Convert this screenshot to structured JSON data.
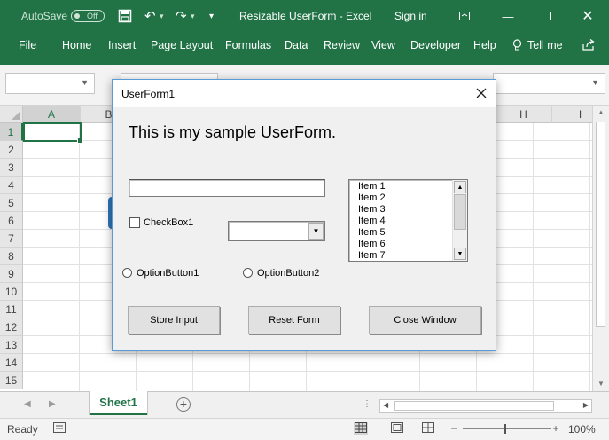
{
  "app": {
    "autosave_label": "AutoSave",
    "autosave_state": "Off",
    "title": "Resizable UserForm  -  Excel",
    "sign_in": "Sign in"
  },
  "ribbon": {
    "tabs": [
      "File",
      "Home",
      "Insert",
      "Page Layout",
      "Formulas",
      "Data",
      "Review",
      "View",
      "Developer",
      "Help",
      "Tell me"
    ]
  },
  "grid": {
    "columns": [
      "A",
      "B",
      "",
      "",
      "",
      "",
      "",
      "",
      "H",
      "I"
    ],
    "rows": [
      "1",
      "2",
      "3",
      "4",
      "5",
      "6",
      "7",
      "8",
      "9",
      "10",
      "11",
      "12",
      "13",
      "14",
      "15"
    ],
    "active_cell": "A1"
  },
  "sheet": {
    "tab_name": "Sheet1"
  },
  "status": {
    "ready": "Ready",
    "zoom": "100%"
  },
  "userform": {
    "title": "UserForm1",
    "heading": "This is my sample UserForm.",
    "textbox_value": "",
    "checkbox_label": "CheckBox1",
    "combo_value": "",
    "option1_label": "OptionButton1",
    "option2_label": "OptionButton2",
    "list_items": [
      "Item 1",
      "Item 2",
      "Item 3",
      "Item 4",
      "Item 5",
      "Item 6",
      "Item 7"
    ],
    "buttons": {
      "store": "Store Input",
      "reset": "Reset Form",
      "close": "Close Window"
    }
  },
  "colors": {
    "excel_green": "#217346",
    "dialog_border": "#5b9bd5"
  }
}
